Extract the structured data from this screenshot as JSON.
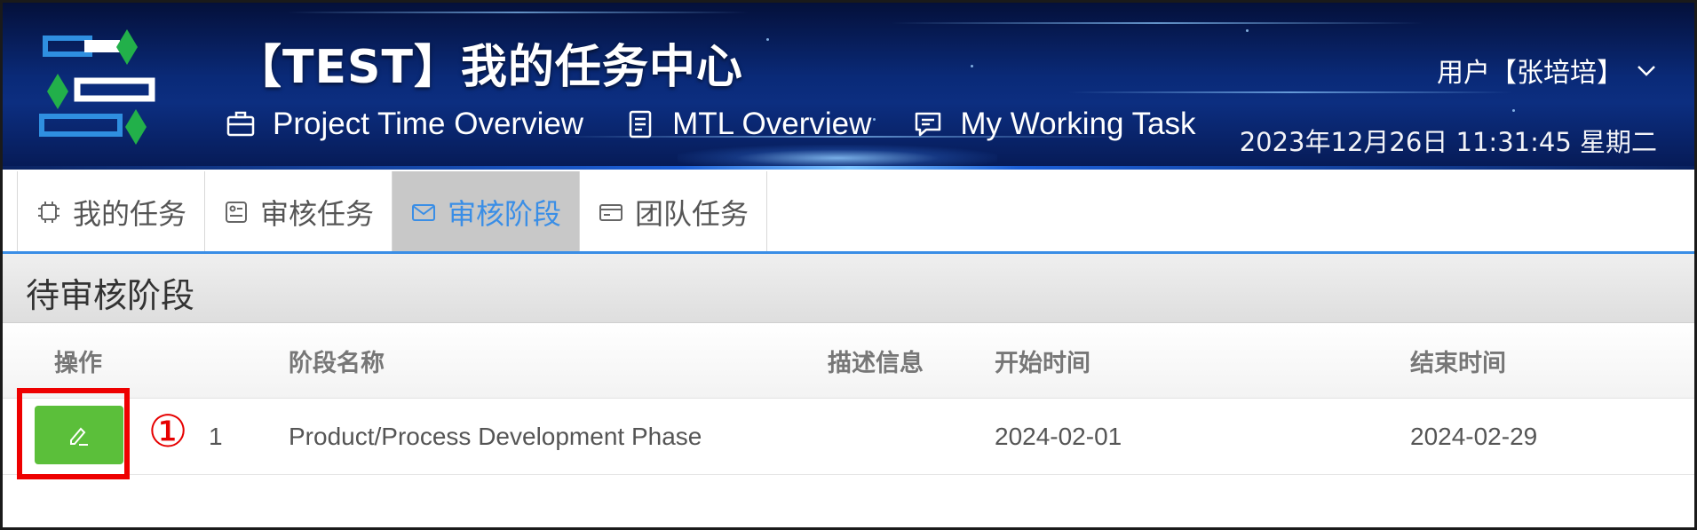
{
  "header": {
    "title": "【TEST】我的任务中心",
    "nav": [
      {
        "icon": "briefcase-icon",
        "label": "Project Time Overview"
      },
      {
        "icon": "document-icon",
        "label": "MTL Overview"
      },
      {
        "icon": "chat-icon",
        "label": "My Working Task"
      }
    ],
    "user_label": "用户【张培培】",
    "datetime": "2023年12月26日  11:31:45  星期二",
    "colors": {
      "accent": "#3a8ee6",
      "background": "#0a2a78"
    }
  },
  "tabs": [
    {
      "icon": "chip-icon",
      "label": "我的任务",
      "active": false
    },
    {
      "icon": "checklist-icon",
      "label": "审核任务",
      "active": false
    },
    {
      "icon": "mail-icon",
      "label": "审核阶段",
      "active": true
    },
    {
      "icon": "card-icon",
      "label": "团队任务",
      "active": false
    }
  ],
  "panel": {
    "title": "待审核阶段",
    "columns": [
      "操作",
      "",
      "阶段名称",
      "描述信息",
      "开始时间",
      "结束时间"
    ],
    "rows": [
      {
        "index": "1",
        "phase_name": "Product/Process Development Phase",
        "description": "",
        "start": "2024-02-01",
        "end": "2024-02-29"
      }
    ]
  },
  "annotation": {
    "callout_number": "①",
    "color": "#ee0000"
  },
  "edit_button_color": "#5bbf3a"
}
